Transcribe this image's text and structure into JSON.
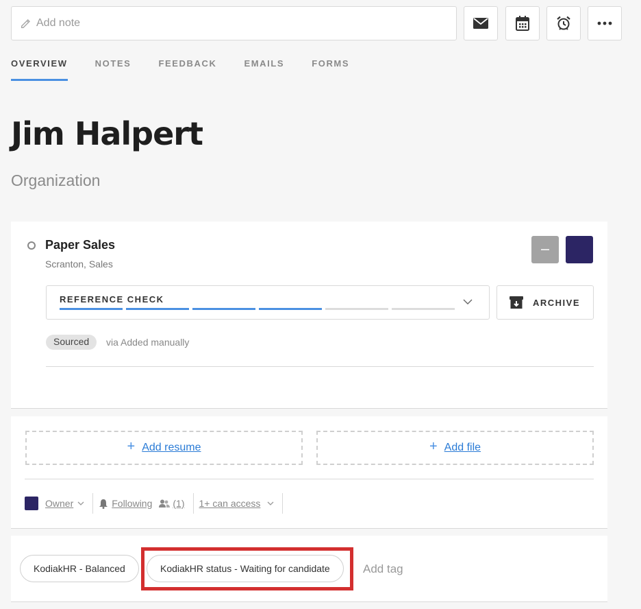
{
  "toolbar": {
    "note_placeholder": "Add note",
    "icons": [
      "envelope-icon",
      "calendar-icon",
      "alarm-clock-icon",
      "more-icon"
    ]
  },
  "tabs": [
    {
      "label": "OVERVIEW",
      "active": true
    },
    {
      "label": "NOTES",
      "active": false
    },
    {
      "label": "FEEDBACK",
      "active": false
    },
    {
      "label": "EMAILS",
      "active": false
    },
    {
      "label": "FORMS",
      "active": false
    }
  ],
  "candidate": {
    "name": "Jim Halpert",
    "organization": "Organization"
  },
  "position": {
    "title": "Paper Sales",
    "subtitle": "Scranton, Sales",
    "stage": "REFERENCE CHECK",
    "stage_progress": {
      "completed": 4,
      "total": 6
    },
    "archive_label": "ARCHIVE",
    "source_badge": "Sourced",
    "source_text": "via Added manually",
    "colors": {
      "accent": "#4a90e2",
      "owner": "#2c2564",
      "gray_square": "#a3a3a3"
    }
  },
  "files": {
    "add_resume": "Add resume",
    "add_file": "Add file"
  },
  "meta": {
    "owner": "Owner",
    "following": "Following",
    "followers_count": "(1)",
    "access": "1+ can access"
  },
  "tags": {
    "items": [
      "KodiakHR - Balanced",
      "KodiakHR status - Waiting for candidate"
    ],
    "add_label": "Add tag",
    "highlight_color": "#d32f2f"
  }
}
